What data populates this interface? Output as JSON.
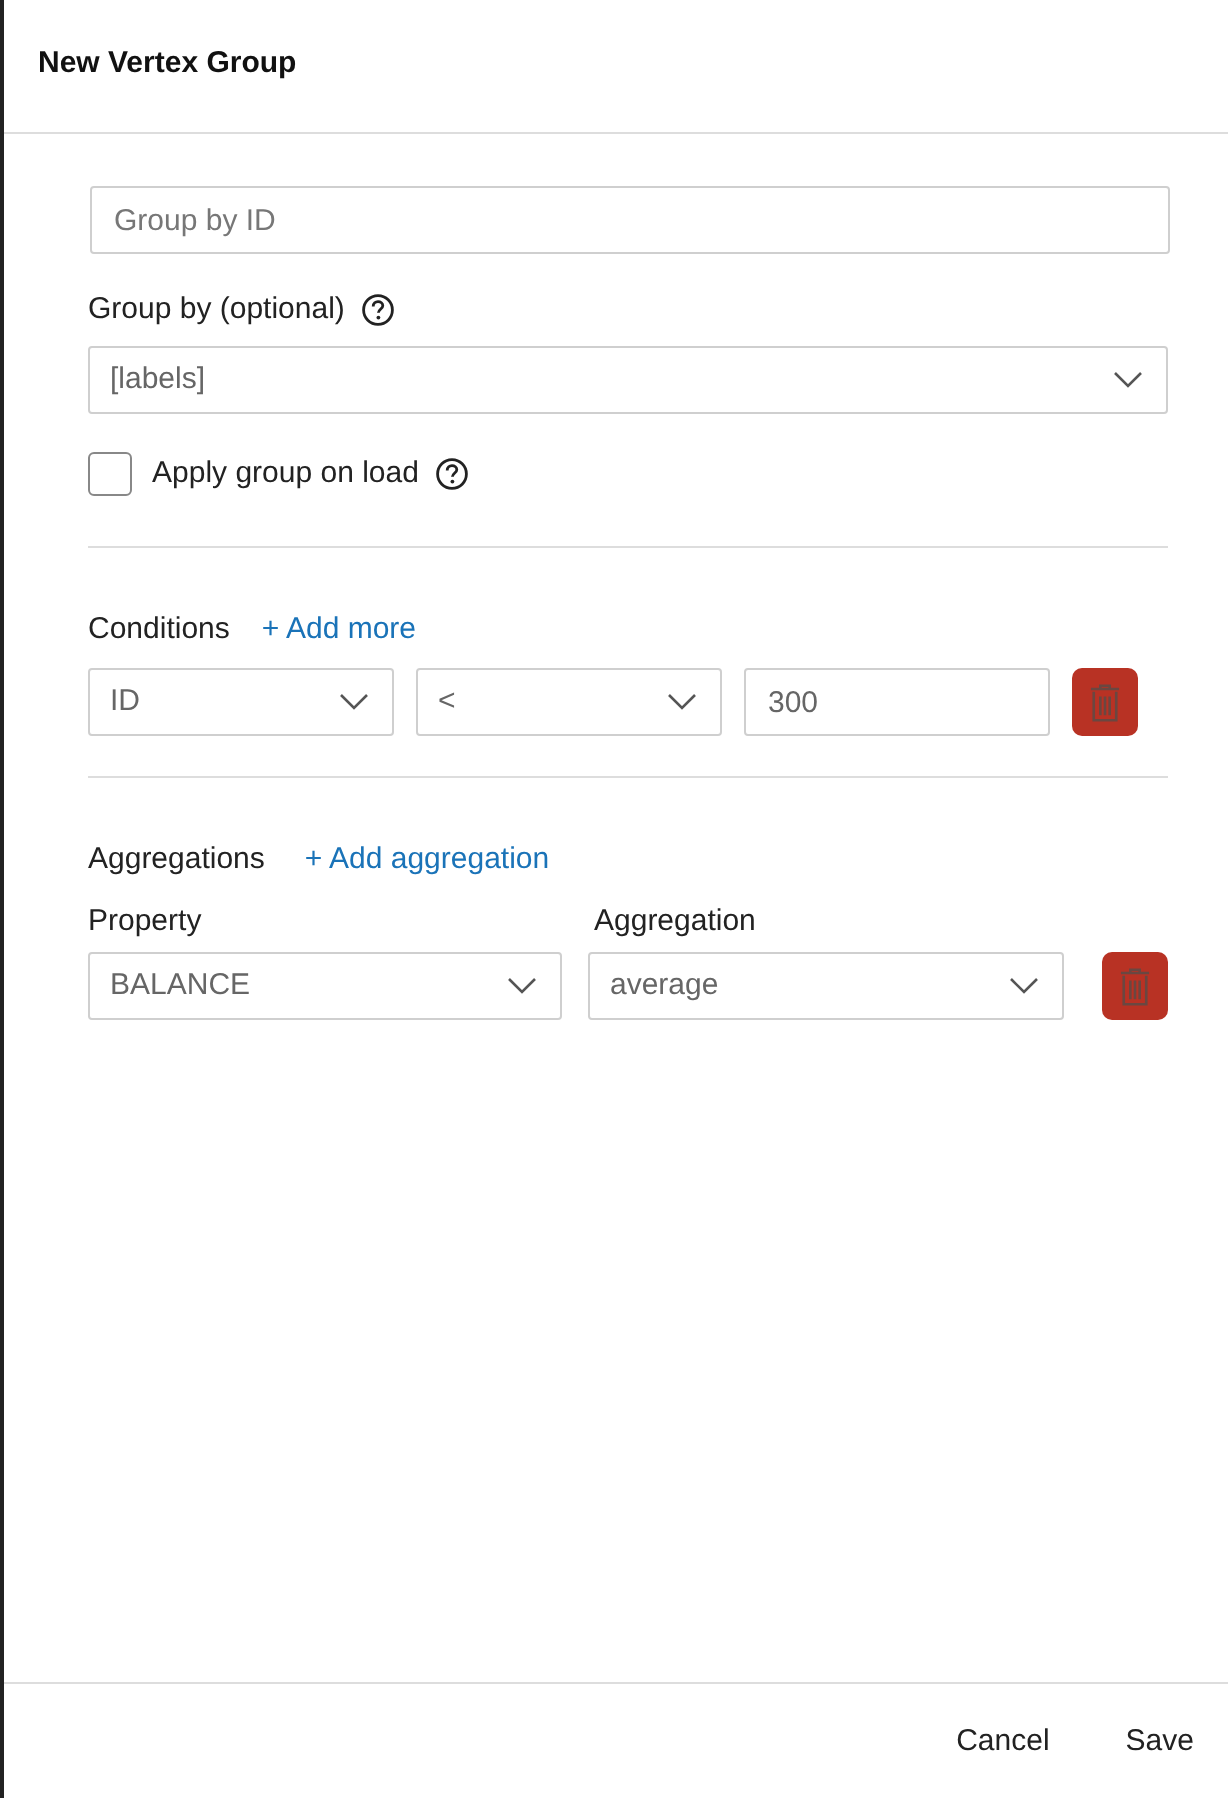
{
  "dialog": {
    "title": "New Vertex Group"
  },
  "name_field": {
    "placeholder": "Group by ID"
  },
  "group_by": {
    "label": "Group by (optional)",
    "value": "[labels]"
  },
  "apply_on_load": {
    "label": "Apply group on load",
    "checked": false
  },
  "conditions": {
    "label": "Conditions",
    "add_link": "+ Add more",
    "rows": [
      {
        "property": "ID",
        "operator": "<",
        "value": "300"
      }
    ]
  },
  "aggregations": {
    "label": "Aggregations",
    "add_link": "+ Add aggregation",
    "columns": [
      "Property",
      "Aggregation"
    ],
    "rows": [
      {
        "property": "BALANCE",
        "aggregation": "average"
      }
    ]
  },
  "footer": {
    "buttons": [
      "Cancel",
      "Save"
    ]
  }
}
